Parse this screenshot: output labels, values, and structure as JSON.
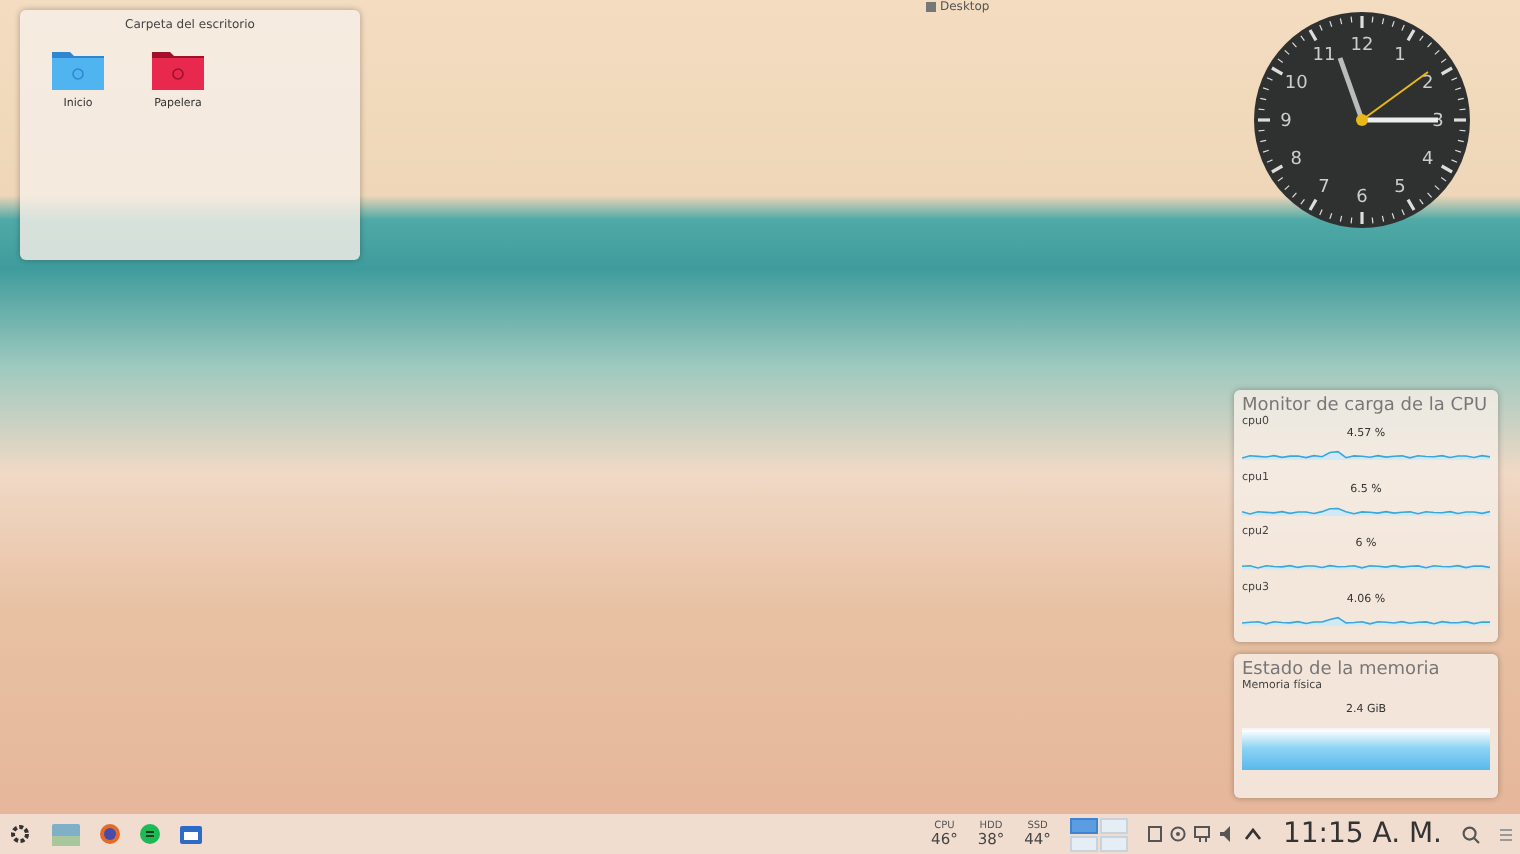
{
  "desktop_label": "Desktop",
  "folder_view": {
    "title": "Carpeta del escritorio",
    "items": [
      {
        "label": "Inicio",
        "kind": "home"
      },
      {
        "label": "Papelera",
        "kind": "trash"
      }
    ]
  },
  "clock": {
    "numerals": [
      "12",
      "1",
      "2",
      "3",
      "4",
      "5",
      "6",
      "7",
      "8",
      "9",
      "10",
      "11"
    ]
  },
  "cpu_monitor": {
    "title": "Monitor de carga de la CPU",
    "cores": [
      {
        "name": "cpu0",
        "reading": "4.57 %"
      },
      {
        "name": "cpu1",
        "reading": "6.5 %"
      },
      {
        "name": "cpu2",
        "reading": "6 %"
      },
      {
        "name": "cpu3",
        "reading": "4.06 %"
      }
    ]
  },
  "memory": {
    "title": "Estado de la memoria",
    "label": "Memoria física",
    "reading": "2.4 GiB"
  },
  "taskbar": {
    "launchers": [
      {
        "kind": "menu"
      },
      {
        "kind": "desktop"
      },
      {
        "kind": "browser"
      },
      {
        "kind": "music"
      },
      {
        "kind": "files"
      }
    ],
    "sensors": [
      {
        "label": "CPU",
        "value": "46°"
      },
      {
        "label": "HDD",
        "value": "38°"
      },
      {
        "label": "SSD",
        "value": "44°"
      }
    ],
    "pager": [
      {
        "selected": true
      },
      {
        "selected": false
      },
      {
        "selected": false
      },
      {
        "selected": false
      }
    ],
    "time": "11:15 A. M."
  }
}
